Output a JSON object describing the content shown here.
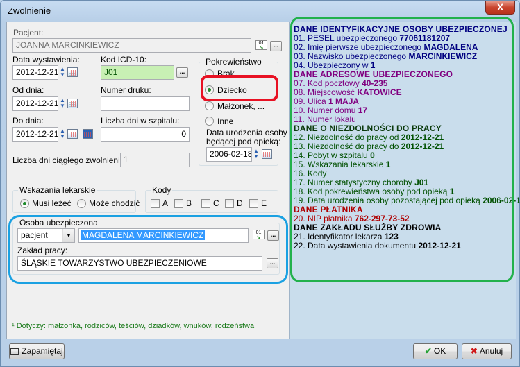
{
  "window": {
    "title": "Zwolnienie",
    "close_glyph": "X"
  },
  "form": {
    "pacjent_label": "Pacjent:",
    "pacjent_value": "JOANNA MARCINKIEWICZ",
    "data_wyst_label": "Data wystawienia:",
    "data_wyst_value": "2012-12-21",
    "kod_icd_label": "Kod ICD-10:",
    "kod_icd_value": "J01",
    "od_dnia_label": "Od dnia:",
    "od_dnia_value": "2012-12-21",
    "numer_druku_label": "Numer druku:",
    "numer_druku_value": "",
    "do_dnia_label": "Do dnia:",
    "do_dnia_value": "2012-12-21",
    "liczba_dni_label": "Liczba dni w szpitalu:",
    "liczba_dni_value": "0",
    "ciaglego_label": "Liczba dni ciągłego zwolnienia:",
    "ciaglego_value": "1",
    "pokrewienstwo": {
      "label": "Pokrewieństwo",
      "options": [
        "Brak",
        "Dziecko",
        "Małżonek, ...",
        "Inne"
      ],
      "selected": "Dziecko",
      "data_ur_label_1": "Data urodzenia osoby",
      "data_ur_label_2": "będącej pod opieką:",
      "data_ur_value": "2006-02-18"
    },
    "wskazania": {
      "label": "Wskazania lekarskie",
      "opt1": "Musi leżeć",
      "opt2": "Może chodzić",
      "selected": "Musi leżeć"
    },
    "kody": {
      "label": "Kody",
      "items": [
        "A",
        "B",
        "C",
        "D",
        "E"
      ]
    },
    "ubezpieczona": {
      "label": "Osoba ubezpieczona",
      "type_value": "pacjent",
      "name_value": "MAGDALENA MARCINKIEWICZ",
      "zaklad_label": "Zakład pracy:",
      "zaklad_value": "ŚLĄSKIE TOWARZYSTWO UBEZPIECZENIOWE"
    },
    "footnote": "¹ Dotyczy: małżonka, rodziców, teściów, dziadków, wnuków, rodzeństwa"
  },
  "info": {
    "h1": "DANE IDENTYFIKACYJNE OSOBY UBEZPIECZONEJ",
    "l01": "01. PESEL ubezpieczonego",
    "v01": "77061181207",
    "l02": "02. Imię pierwsze ubezpieczonego",
    "v02": "MAGDALENA",
    "l03": "03. Nazwisko ubezpieczonego",
    "v03": "MARCINKIEWICZ",
    "l04": "04. Ubezpieczony w",
    "v04": "1",
    "h2": "DANE ADRESOWE UBEZPIECZONEGO",
    "l07": "07. Kod pocztowy",
    "v07": "40-235",
    "l08": "08. Miejscowość",
    "v08": "KATOWICE",
    "l09": "09. Ulica",
    "v09": "1 MAJA",
    "l10": "10. Numer domu",
    "v10": "17",
    "l11": "11. Numer lokalu",
    "v11": "",
    "h3": "DANE O NIEZDOLNOŚCI DO PRACY",
    "l12": "12. Niezdolność do pracy od",
    "v12": "2012-12-21",
    "l13": "13. Niezdolność do pracy do",
    "v13": "2012-12-21",
    "l14": "14. Pobyt w szpitalu",
    "v14": "0",
    "l15": "15. Wskazania lekarskie",
    "v15": "1",
    "l16": "16. Kody",
    "v16": "",
    "l17": "17. Numer statystyczny choroby",
    "v17": "J01",
    "l18": "18. Kod pokrewieństwa osoby pod opieką",
    "v18": "1",
    "l19": "19. Data urodzenia osoby pozostającej pod opieką",
    "v19": "2006-02-18",
    "h4": "DANE PŁATNIKA",
    "l20": "20. NIP płatnika",
    "v20": "762-297-73-52",
    "h5": "DANE ZAKŁADU SŁUŻBY ZDROWIA",
    "l21": "21. Identyfikator lekarza",
    "v21": "123",
    "l22": "22. Data wystawienia dokumentu",
    "v22": "2012-12-21"
  },
  "buttons": {
    "remember": "Zapamiętaj",
    "ok": "OK",
    "cancel": "Anuluj"
  },
  "colors": {
    "annotation_green": "#22b14c",
    "annotation_blue": "#1ba1e2",
    "annotation_red": "#e81123"
  }
}
